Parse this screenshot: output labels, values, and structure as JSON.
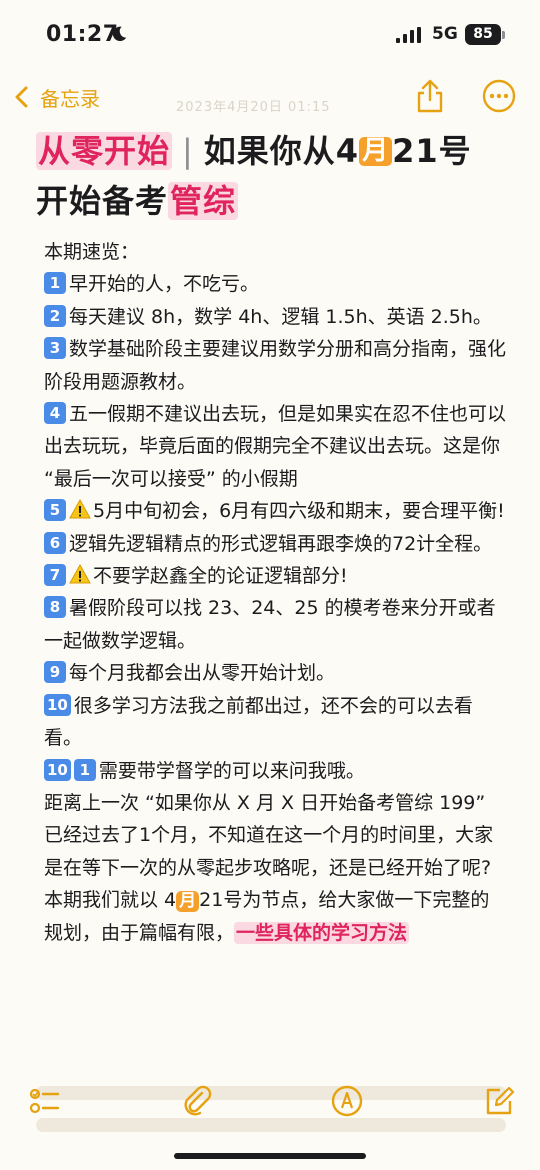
{
  "status_bar": {
    "time": "01:27",
    "network": "5G",
    "battery": "85"
  },
  "nav": {
    "back_label": "备忘录",
    "date": "2023年4月20日 01:15"
  },
  "title": {
    "part1": "从零开始",
    "separator": "|",
    "part2": "如果你从4",
    "month_char": "月",
    "part3": "21号",
    "line2_plain": "开始备考",
    "line2_highlight": "管综"
  },
  "body": {
    "intro": "本期速览：",
    "items": [
      {
        "num": "1",
        "text": "早开始的人，不吃亏。"
      },
      {
        "num": "2",
        "text": "每天建议 8h，数学 4h、逻辑 1.5h、英语 2.5h。"
      },
      {
        "num": "3",
        "text": "数学基础阶段主要建议用数学分册和高分指南，强化阶段用题源教材。"
      },
      {
        "num": "4",
        "text": "五一假期不建议出去玩，但是如果实在忍不住也可以出去玩玩，毕竟后面的假期完全不建议出去玩。这是你 “最后一次可以接受” 的小假期"
      },
      {
        "num": "5",
        "text": "5月中旬初会，6月有四六级和期末，要合理平衡!"
      },
      {
        "num": "6",
        "text": "逻辑先逻辑精点的形式逻辑再跟李焕的72计全程。"
      },
      {
        "num": "7",
        "text": "不要学赵鑫全的论证逻辑部分!"
      },
      {
        "num": "8",
        "text": "暑假阶段可以找 23、24、25 的模考卷来分开或者一起做数学逻辑。"
      },
      {
        "num": "9",
        "text": "每个月我都会出从零开始计划。"
      },
      {
        "num": "10",
        "text": "很多学习方法我之前都出过，还不会的可以去看看。"
      },
      {
        "num": "11",
        "num_a": "10",
        "num_b": "1",
        "text": "需要带学督学的可以来问我哦。"
      }
    ],
    "para1": "距离上一次 “如果你从 X 月 X 日开始备考管综 199” 已经过去了1个月，不知道在这一个月的时间里，大家是在等下一次的从零起步攻略呢，还是已经开始了呢?",
    "para2_a": "本期我们就以 4",
    "para2_month": "月",
    "para2_b": "21号为节点，给大家做一下完整的规划，由于篇幅有限，",
    "para2_highlight": "一些具体的学习方法"
  },
  "colors": {
    "accent": "#e5a211",
    "highlight_text": "#e0245e",
    "highlight_bg": "#fbd9e3",
    "keycap": "#4b8be8",
    "month_badge": "#f5a02a"
  },
  "icons": [
    "moon-icon",
    "signal-icon",
    "chevron-left-icon",
    "share-icon",
    "more-icon",
    "warning-icon",
    "checklist-icon",
    "paperclip-icon",
    "markup-icon",
    "compose-icon"
  ]
}
